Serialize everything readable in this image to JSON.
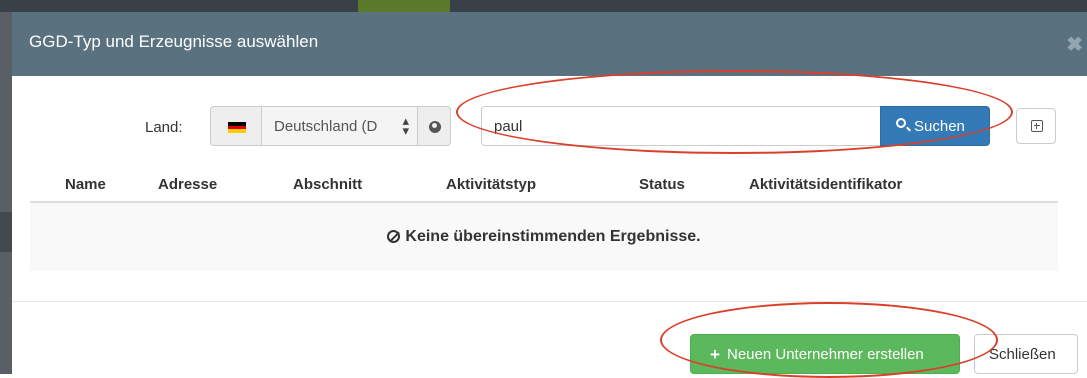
{
  "modal": {
    "title": "GGD-Typ und Erzeugnisse auswählen",
    "close_icon": "close-icon"
  },
  "search": {
    "land_label": "Land:",
    "country_value": "Deutschland (D",
    "query": "paul",
    "button_label": "Suchen",
    "flag_colors": [
      "#000000",
      "#dd0000",
      "#ffce00"
    ]
  },
  "table": {
    "columns": [
      "Name",
      "Adresse",
      "Abschnitt",
      "Aktivitätstyp",
      "Status",
      "Aktivitätsidentifikator"
    ],
    "empty_message": "Keine übereinstimmenden Ergebnisse."
  },
  "footer": {
    "create_label": "Neuen Unternehmer erstellen",
    "close_label": "Schließen"
  },
  "colors": {
    "header": "#5a7180",
    "primary": "#337ab7",
    "success": "#5cb85c",
    "annotation": "#d9402b"
  }
}
